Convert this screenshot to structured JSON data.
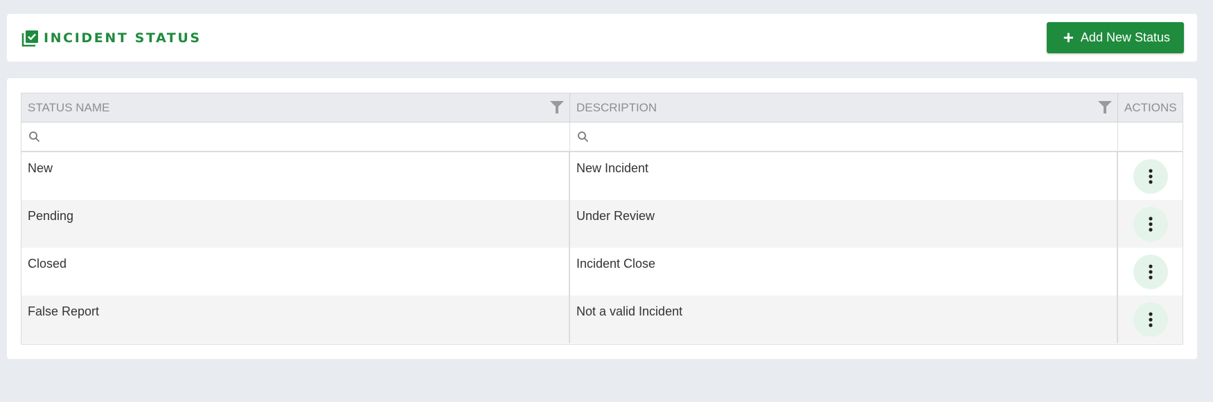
{
  "header": {
    "title": "INCIDENT STATUS",
    "title_icon": "checklist-icon",
    "add_button_label": "Add New Status",
    "add_button_icon": "plus-icon"
  },
  "colors": {
    "accent": "#1f8b3d",
    "action_bg": "#e5f4ea",
    "page_bg": "#e8ebf0"
  },
  "grid": {
    "columns": [
      {
        "label": "STATUS NAME",
        "filterable": true
      },
      {
        "label": "DESCRIPTION",
        "filterable": true
      },
      {
        "label": "ACTIONS",
        "filterable": false
      }
    ],
    "filters": {
      "status_name": "",
      "description": ""
    },
    "rows": [
      {
        "status_name": "New",
        "description": "New Incident"
      },
      {
        "status_name": "Pending",
        "description": "Under Review"
      },
      {
        "status_name": "Closed",
        "description": "Incident Close"
      },
      {
        "status_name": "False Report",
        "description": "Not a valid Incident"
      }
    ]
  }
}
